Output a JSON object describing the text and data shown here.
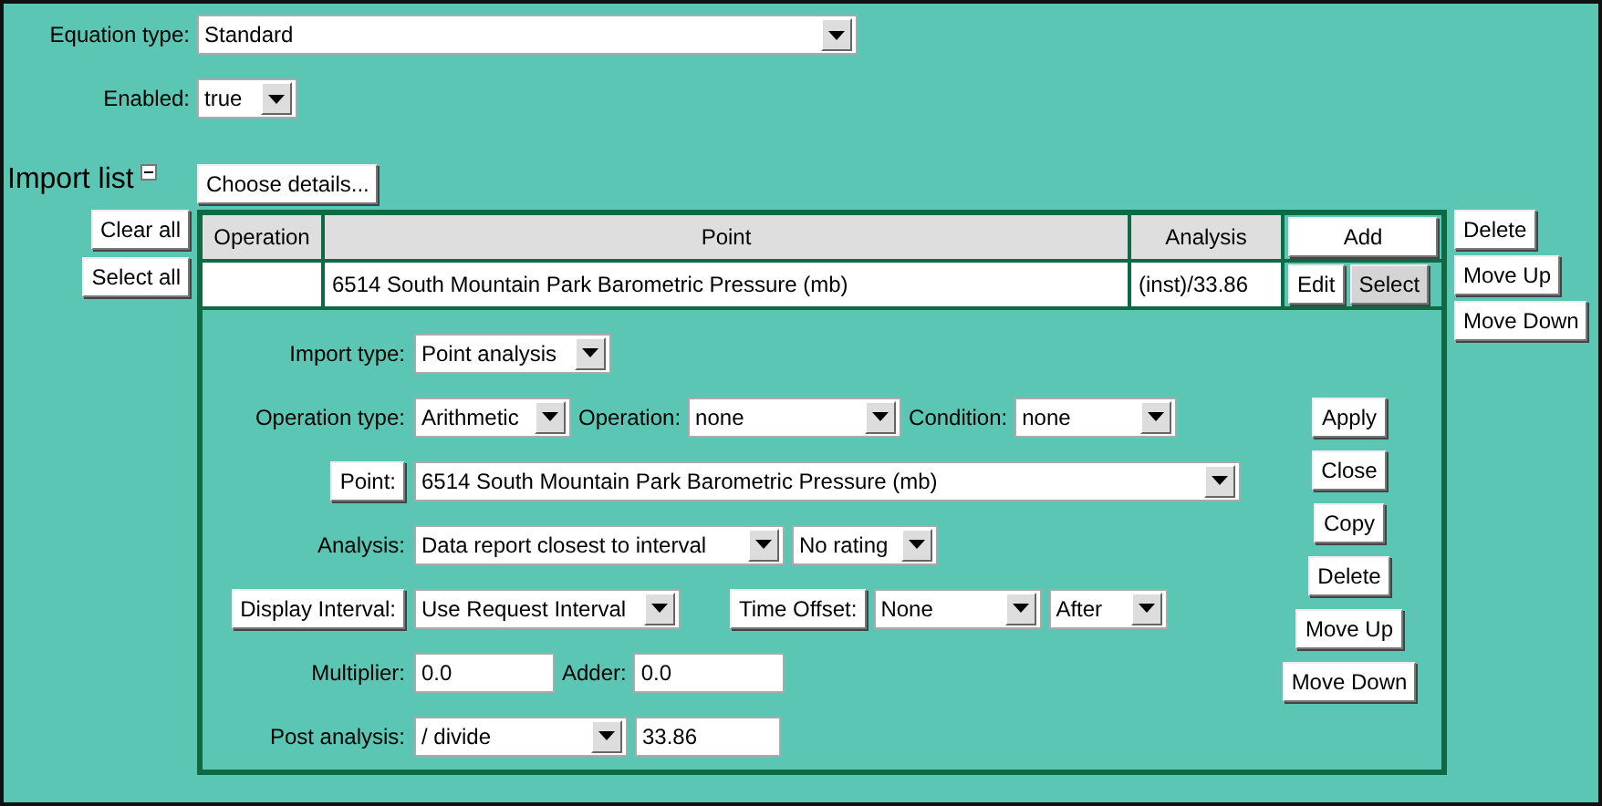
{
  "equation_type": {
    "label": "Equation type:",
    "value": "Standard"
  },
  "enabled": {
    "label": "Enabled:",
    "value": "true"
  },
  "import_list": {
    "title": "Import list",
    "expanded": true,
    "choose_button": "Choose details...",
    "left_buttons": [
      "Clear all",
      "Select all"
    ],
    "right_buttons": [
      "Delete",
      "Move Up",
      "Move Down"
    ],
    "table": {
      "columns": [
        "Operation",
        "Point",
        "Analysis"
      ],
      "add_button": "Add",
      "rows": [
        {
          "point": "6514 South Mountain Park Barometric Pressure (mb)",
          "analysis": "(inst)/33.86",
          "edit_button": "Edit",
          "select_button": {
            "label": "Select",
            "pressed": true
          }
        }
      ]
    },
    "detail": {
      "fields": [
        {
          "items": [
            {
              "kind": "label",
              "text": "Import type:"
            },
            {
              "kind": "select",
              "value": "Point analysis"
            }
          ]
        },
        {
          "items": [
            {
              "kind": "label",
              "text": "Operation type:"
            },
            {
              "kind": "select",
              "value": "Arithmetic"
            },
            {
              "kind": "label",
              "text": "Operation:"
            },
            {
              "kind": "select",
              "value": "none"
            },
            {
              "kind": "label",
              "text": "Condition:"
            },
            {
              "kind": "select",
              "value": "none"
            }
          ]
        },
        {
          "items": [
            {
              "kind": "button",
              "text": "Point:"
            },
            {
              "kind": "select",
              "value": "6514 South Mountain Park Barometric Pressure (mb)"
            }
          ]
        },
        {
          "items": [
            {
              "kind": "label",
              "text": "Analysis:"
            },
            {
              "kind": "select",
              "value": "Data report closest to interval"
            },
            {
              "kind": "select",
              "value": "No rating"
            }
          ]
        },
        {
          "items": [
            {
              "kind": "button",
              "text": "Display Interval:"
            },
            {
              "kind": "select",
              "value": "Use Request Interval"
            },
            {
              "kind": "button",
              "text": "Time Offset:"
            },
            {
              "kind": "select",
              "value": "None"
            },
            {
              "kind": "select",
              "value": "After"
            }
          ]
        },
        {
          "items": [
            {
              "kind": "label",
              "text": "Multiplier:"
            },
            {
              "kind": "input",
              "value": "0.0"
            },
            {
              "kind": "label",
              "text": "Adder:"
            },
            {
              "kind": "input",
              "value": "0.0"
            }
          ]
        },
        {
          "items": [
            {
              "kind": "label",
              "text": "Post analysis:"
            },
            {
              "kind": "select",
              "value": "/ divide"
            },
            {
              "kind": "input",
              "value": "33.86"
            }
          ]
        }
      ],
      "buttons": [
        "Apply",
        "Close",
        "Copy",
        "Delete",
        "Move Up",
        "Move Down"
      ]
    }
  }
}
